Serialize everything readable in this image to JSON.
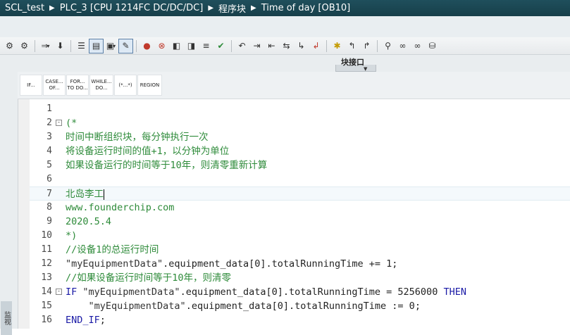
{
  "breadcrumb": {
    "items": [
      "SCL_test",
      "PLC_3 [CPU 1214FC DC/DC/DC]",
      "程序块",
      "Time of day [OB10]"
    ]
  },
  "toolbar": {
    "icons": [
      "compare-icon",
      "compare-all-icon",
      "insert-block-icon",
      "download-icon",
      "network-icon",
      "call-list-icon",
      "block-interface-icon",
      "monitor-icon",
      "toggle-comments-icon",
      "breakpoint-icon",
      "clear-breakpoint-icon",
      "nav-prev-icon",
      "nav-next-icon",
      "goto-icon",
      "run-icon",
      "indent-icon",
      "outdent-icon",
      "align-icon",
      "step-in-icon",
      "step-out-icon",
      "bookmark-icon",
      "prev-bookmark-icon",
      "next-bookmark-icon",
      "watch-icon",
      "monitor-all-icon",
      "show-all-icon",
      "db-icon"
    ]
  },
  "panel": {
    "title": "块接口"
  },
  "sidetab": {
    "label": "监视"
  },
  "snippets": [
    "IF...",
    "CASE... OF...",
    "FOR... TO DO...",
    "WHILE... DO...",
    "(*...*)",
    "REGION"
  ],
  "editor": {
    "current_line": 7,
    "lines": [
      {
        "n": "1",
        "fold": "",
        "parts": []
      },
      {
        "n": "2",
        "fold": "-",
        "parts": [
          {
            "t": "(*",
            "c": "cmt"
          }
        ]
      },
      {
        "n": "3",
        "fold": "",
        "parts": [
          {
            "t": "时间中断组织块，每分钟执行一次",
            "c": "cmt"
          }
        ]
      },
      {
        "n": "4",
        "fold": "",
        "parts": [
          {
            "t": "将设备运行时间的值+1，以分钟为单位",
            "c": "cmt"
          }
        ]
      },
      {
        "n": "5",
        "fold": "",
        "parts": [
          {
            "t": "如果设备运行的时间等于10年，则清零重新计算",
            "c": "cmt"
          }
        ]
      },
      {
        "n": "6",
        "fold": "",
        "parts": []
      },
      {
        "n": "7",
        "fold": "",
        "parts": [
          {
            "t": "北岛李工",
            "c": "cmt"
          }
        ]
      },
      {
        "n": "8",
        "fold": "",
        "parts": [
          {
            "t": "www.founderchip.com",
            "c": "cmt"
          }
        ]
      },
      {
        "n": "9",
        "fold": "",
        "parts": [
          {
            "t": "2020.5.4",
            "c": "cmt"
          }
        ]
      },
      {
        "n": "10",
        "fold": "",
        "parts": [
          {
            "t": "*)",
            "c": "cmt"
          }
        ]
      },
      {
        "n": "11",
        "fold": "",
        "parts": [
          {
            "t": "//设备1的总运行时间",
            "c": "cmt"
          }
        ]
      },
      {
        "n": "12",
        "fold": "",
        "parts": [
          {
            "t": "\"myEquipmentData\"",
            "c": "str"
          },
          {
            "t": ".equipment_data[0].totalRunningTime += ",
            "c": "txt"
          },
          {
            "t": "1",
            "c": "num"
          },
          {
            "t": ";",
            "c": "txt"
          }
        ]
      },
      {
        "n": "13",
        "fold": "",
        "parts": [
          {
            "t": "//如果设备运行时间等于10年，则清零",
            "c": "cmt"
          }
        ]
      },
      {
        "n": "14",
        "fold": "-",
        "parts": [
          {
            "t": "IF ",
            "c": "kw"
          },
          {
            "t": "\"myEquipmentData\"",
            "c": "str"
          },
          {
            "t": ".equipment_data[0].totalRunningTime = ",
            "c": "txt"
          },
          {
            "t": "5256000",
            "c": "num"
          },
          {
            "t": " THEN",
            "c": "kw"
          }
        ]
      },
      {
        "n": "15",
        "fold": "",
        "parts": [
          {
            "t": "    \"myEquipmentData\"",
            "c": "str"
          },
          {
            "t": ".equipment_data[0].totalRunningTime := ",
            "c": "txt"
          },
          {
            "t": "0",
            "c": "num"
          },
          {
            "t": ";",
            "c": "txt"
          }
        ]
      },
      {
        "n": "16",
        "fold": "",
        "parts": [
          {
            "t": "END_IF",
            "c": "kw"
          },
          {
            "t": ";",
            "c": "txt"
          }
        ]
      }
    ]
  }
}
